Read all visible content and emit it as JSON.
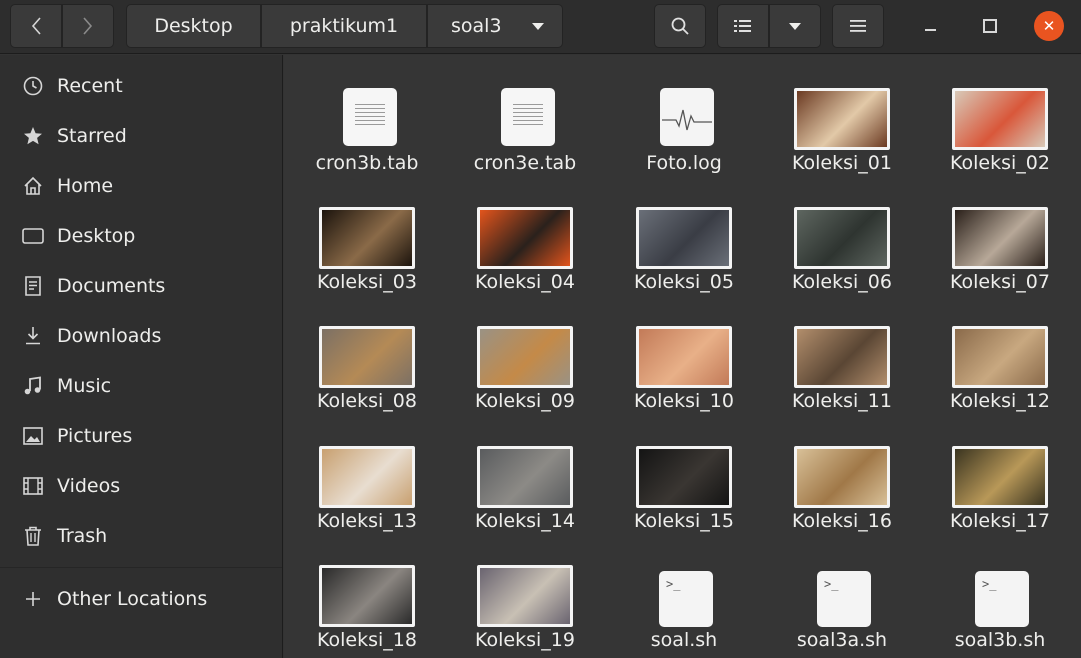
{
  "breadcrumb": [
    "Desktop",
    "praktikum1",
    "soal3"
  ],
  "window_controls": {
    "close_glyph": "✕"
  },
  "sidebar": {
    "items": [
      {
        "label": "Recent",
        "icon": "clock-icon"
      },
      {
        "label": "Starred",
        "icon": "star-icon"
      },
      {
        "label": "Home",
        "icon": "home-icon"
      },
      {
        "label": "Desktop",
        "icon": "desktop-icon"
      },
      {
        "label": "Documents",
        "icon": "documents-icon"
      },
      {
        "label": "Downloads",
        "icon": "downloads-icon"
      },
      {
        "label": "Music",
        "icon": "music-icon"
      },
      {
        "label": "Pictures",
        "icon": "pictures-icon"
      },
      {
        "label": "Videos",
        "icon": "videos-icon"
      },
      {
        "label": "Trash",
        "icon": "trash-icon"
      }
    ],
    "other_locations": "Other Locations"
  },
  "files": [
    {
      "name": "cron3b.tab",
      "kind": "text"
    },
    {
      "name": "cron3e.tab",
      "kind": "text"
    },
    {
      "name": "Foto.log",
      "kind": "log"
    },
    {
      "name": "Koleksi_01",
      "kind": "image",
      "colors": [
        "#6b3a22",
        "#e2c9a8"
      ]
    },
    {
      "name": "Koleksi_02",
      "kind": "image",
      "colors": [
        "#d8c9b8",
        "#d9573a"
      ]
    },
    {
      "name": "Koleksi_03",
      "kind": "image",
      "colors": [
        "#1c140d",
        "#8a6a48"
      ]
    },
    {
      "name": "Koleksi_04",
      "kind": "image",
      "colors": [
        "#e2541c",
        "#2a211c"
      ]
    },
    {
      "name": "Koleksi_05",
      "kind": "image",
      "colors": [
        "#6a6f78",
        "#3a3d45"
      ]
    },
    {
      "name": "Koleksi_06",
      "kind": "image",
      "colors": [
        "#5e6660",
        "#2e3430"
      ]
    },
    {
      "name": "Koleksi_07",
      "kind": "image",
      "colors": [
        "#2a201a",
        "#b7a898"
      ]
    },
    {
      "name": "Koleksi_08",
      "kind": "image",
      "colors": [
        "#7c7064",
        "#b48a56"
      ]
    },
    {
      "name": "Koleksi_09",
      "kind": "image",
      "colors": [
        "#9a9284",
        "#c48a48"
      ]
    },
    {
      "name": "Koleksi_10",
      "kind": "image",
      "colors": [
        "#c27a58",
        "#e8b088"
      ]
    },
    {
      "name": "Koleksi_11",
      "kind": "image",
      "colors": [
        "#b28e6c",
        "#5a4634"
      ]
    },
    {
      "name": "Koleksi_12",
      "kind": "image",
      "colors": [
        "#8a6a4a",
        "#c8a880"
      ]
    },
    {
      "name": "Koleksi_13",
      "kind": "image",
      "colors": [
        "#c8a070",
        "#e8ddd0"
      ]
    },
    {
      "name": "Koleksi_14",
      "kind": "image",
      "colors": [
        "#5a5c5e",
        "#8c8a86"
      ]
    },
    {
      "name": "Koleksi_15",
      "kind": "image",
      "colors": [
        "#141414",
        "#3a3632"
      ]
    },
    {
      "name": "Koleksi_16",
      "kind": "image",
      "colors": [
        "#d8c098",
        "#a07848"
      ]
    },
    {
      "name": "Koleksi_17",
      "kind": "image",
      "colors": [
        "#3a3420",
        "#b89858"
      ]
    },
    {
      "name": "Koleksi_18",
      "kind": "image",
      "colors": [
        "#2a2a2a",
        "#8a8580"
      ]
    },
    {
      "name": "Koleksi_19",
      "kind": "image",
      "colors": [
        "#6a6470",
        "#c8c0b4"
      ]
    },
    {
      "name": "soal.sh",
      "kind": "script"
    },
    {
      "name": "soal3a.sh",
      "kind": "script"
    },
    {
      "name": "soal3b.sh",
      "kind": "script"
    }
  ],
  "script_prompt": ">_",
  "colors": {
    "accent": "#e95420",
    "background": "#353535",
    "sidebar": "#2f2f2f"
  }
}
